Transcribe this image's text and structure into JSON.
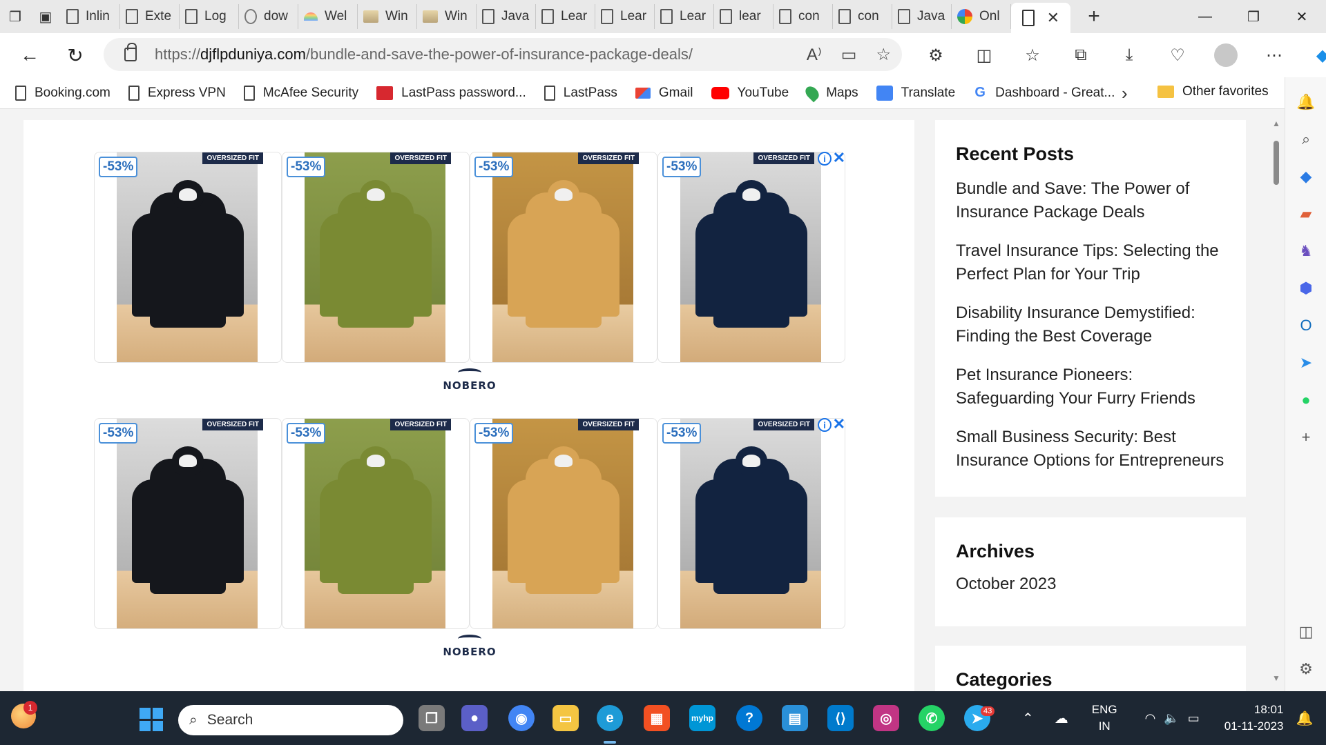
{
  "tabs": [
    {
      "label": "Inlin",
      "icon": "page-icon"
    },
    {
      "label": "Exte",
      "icon": "page-icon"
    },
    {
      "label": "Log",
      "icon": "page-icon"
    },
    {
      "label": "dow",
      "icon": "download-icon"
    },
    {
      "label": "Wel",
      "icon": "rainbow-icon"
    },
    {
      "label": "Win",
      "icon": "image-icon"
    },
    {
      "label": "Win",
      "icon": "image-icon"
    },
    {
      "label": "Java",
      "icon": "page-icon"
    },
    {
      "label": "Lear",
      "icon": "page-icon"
    },
    {
      "label": "Lear",
      "icon": "page-icon"
    },
    {
      "label": "Lear",
      "icon": "page-icon"
    },
    {
      "label": "lear",
      "icon": "page-icon"
    },
    {
      "label": "con",
      "icon": "page-icon"
    },
    {
      "label": "con",
      "icon": "page-icon"
    },
    {
      "label": "Java",
      "icon": "page-icon"
    },
    {
      "label": "Onl",
      "icon": "google-icon"
    }
  ],
  "address_bar": {
    "url_prefix": "https://",
    "domain": "djflpduniya.com",
    "path": "/bundle-and-save-the-power-of-insurance-package-deals/"
  },
  "favorites": [
    {
      "label": "Booking.com",
      "icon": "page-icon"
    },
    {
      "label": "Express VPN",
      "icon": "page-icon"
    },
    {
      "label": "McAfee Security",
      "icon": "page-icon"
    },
    {
      "label": "LastPass password...",
      "icon": "lastpass-icon"
    },
    {
      "label": "LastPass",
      "icon": "page-icon"
    },
    {
      "label": "Gmail",
      "icon": "gmail-icon"
    },
    {
      "label": "YouTube",
      "icon": "youtube-icon"
    },
    {
      "label": "Maps",
      "icon": "maps-icon"
    },
    {
      "label": "Translate",
      "icon": "translate-icon"
    },
    {
      "label": "Dashboard - Great...",
      "icon": "g-icon"
    }
  ],
  "favorites_other": "Other favorites",
  "ads": {
    "discount": "-53%",
    "ribbon": "OVERSIZED FIT",
    "brand": "NOBERO",
    "info_symbol": "i",
    "close_symbol": "✕",
    "colors": [
      "black",
      "green",
      "amber",
      "navy"
    ]
  },
  "sidebar": {
    "recent_posts": {
      "title": "Recent Posts",
      "items": [
        "Bundle and Save: The Power of Insurance Package Deals",
        "Travel Insurance Tips: Selecting the Perfect Plan for Your Trip",
        "Disability Insurance Demystified: Finding the Best Coverage",
        "Pet Insurance Pioneers: Safeguarding Your Furry Friends",
        "Small Business Security: Best Insurance Options for Entrepreneurs"
      ]
    },
    "archives": {
      "title": "Archives",
      "items": [
        "October 2023"
      ]
    },
    "categories": {
      "title": "Categories"
    }
  },
  "taskbar": {
    "weather_badge": "1",
    "search_placeholder": "Search",
    "telegram_badge": "43",
    "language": "ENG",
    "region": "IN",
    "time": "18:01",
    "date": "01-11-2023",
    "myhp_label": "myhp"
  },
  "colors": {
    "accent": "#1a73e8",
    "discount_border": "#4a90d9",
    "brand_navy": "#1d2b4a",
    "taskbar": "#1d2733"
  }
}
